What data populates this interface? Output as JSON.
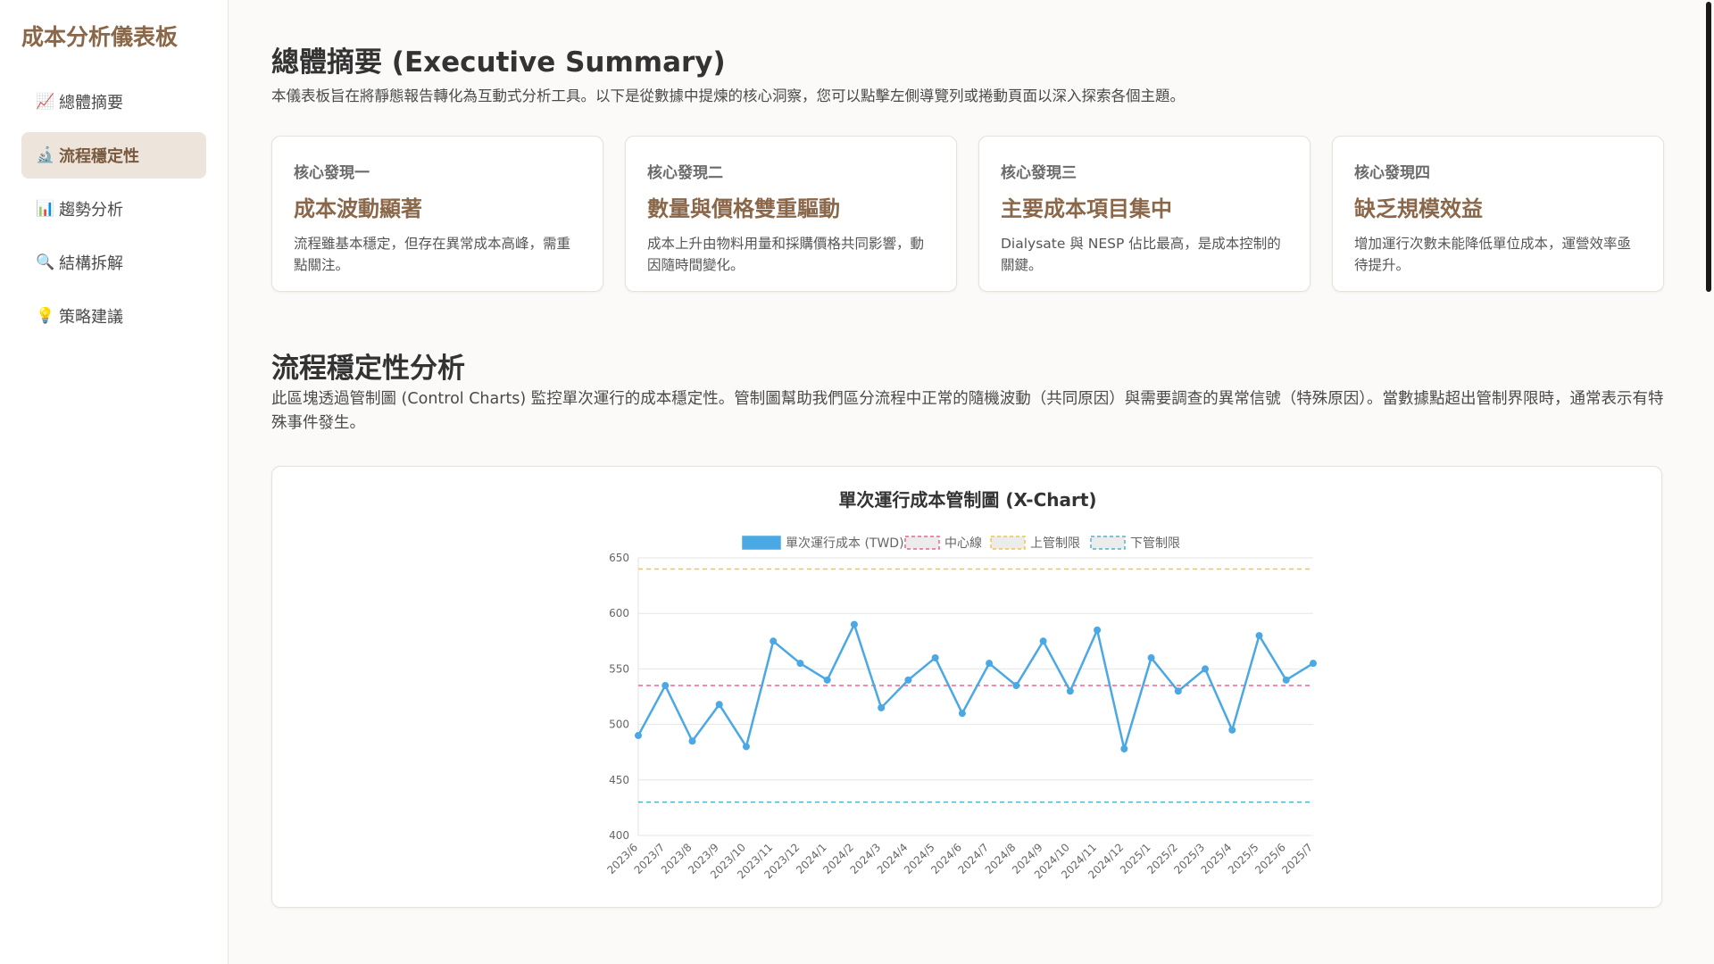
{
  "sidebar": {
    "brand": "成本分析儀表板",
    "items": [
      {
        "icon": "📈",
        "label": "總體摘要",
        "active": false
      },
      {
        "icon": "🔬",
        "label": "流程穩定性",
        "active": true
      },
      {
        "icon": "📊",
        "label": "趨勢分析",
        "active": false
      },
      {
        "icon": "🔍",
        "label": "結構拆解",
        "active": false
      },
      {
        "icon": "💡",
        "label": "策略建議",
        "active": false
      }
    ]
  },
  "summary": {
    "title": "總體摘要 (Executive Summary)",
    "lead": "本儀表板旨在將靜態報告轉化為互動式分析工具。以下是從數據中提煉的核心洞察，您可以點擊左側導覽列或捲動頁面以深入探索各個主題。",
    "cards": [
      {
        "kicker": "核心發現一",
        "title": "成本波動顯著",
        "desc": "流程雖基本穩定，但存在異常成本高峰，需重點關注。"
      },
      {
        "kicker": "核心發現二",
        "title": "數量與價格雙重驅動",
        "desc": "成本上升由物料用量和採購價格共同影響，動因隨時間變化。"
      },
      {
        "kicker": "核心發現三",
        "title": "主要成本項目集中",
        "desc": "Dialysate 與 NESP 佔比最高，是成本控制的關鍵。"
      },
      {
        "kicker": "核心發現四",
        "title": "缺乏規模效益",
        "desc": "增加運行次數未能降低單位成本，運營效率亟待提升。"
      }
    ]
  },
  "stability": {
    "title": "流程穩定性分析",
    "desc": "此區塊透過管制圖 (Control Charts) 監控單次運行的成本穩定性。管制圖幫助我們區分流程中正常的隨機波動（共同原因）與需要調查的異常信號（特殊原因）。當數據點超出管制界限時，通常表示有特殊事件發生。"
  },
  "chart_data": {
    "type": "line",
    "title": "單次運行成本管制圖 (X-Chart)",
    "xlabel": "",
    "ylabel": "",
    "ylim": [
      400,
      650
    ],
    "yticks": [
      400,
      450,
      500,
      550,
      600,
      650
    ],
    "grid": true,
    "legend_position": "top",
    "x": [
      "2023/6",
      "2023/7",
      "2023/8",
      "2023/9",
      "2023/10",
      "2023/11",
      "2023/12",
      "2024/1",
      "2024/2",
      "2024/3",
      "2024/4",
      "2024/5",
      "2024/6",
      "2024/7",
      "2024/8",
      "2024/9",
      "2024/10",
      "2024/11",
      "2024/12",
      "2025/1",
      "2025/2",
      "2025/3",
      "2025/4",
      "2025/5",
      "2025/6",
      "2025/7"
    ],
    "series": [
      {
        "name": "單次運行成本 (TWD)",
        "color": "#4aa8e4",
        "style": "solid",
        "values": [
          490,
          535,
          485,
          518,
          480,
          575,
          555,
          540,
          590,
          515,
          540,
          560,
          510,
          555,
          535,
          575,
          530,
          585,
          478,
          560,
          530,
          550,
          495,
          580,
          540,
          555
        ]
      },
      {
        "name": "中心線",
        "color": "#f06292",
        "style": "dashed",
        "values": [
          535
        ]
      },
      {
        "name": "上管制限",
        "color": "#f5c542",
        "style": "dashed",
        "values": [
          640
        ]
      },
      {
        "name": "下管制限",
        "color": "#4fb3cf",
        "style": "dashed",
        "values": [
          430
        ]
      }
    ]
  }
}
